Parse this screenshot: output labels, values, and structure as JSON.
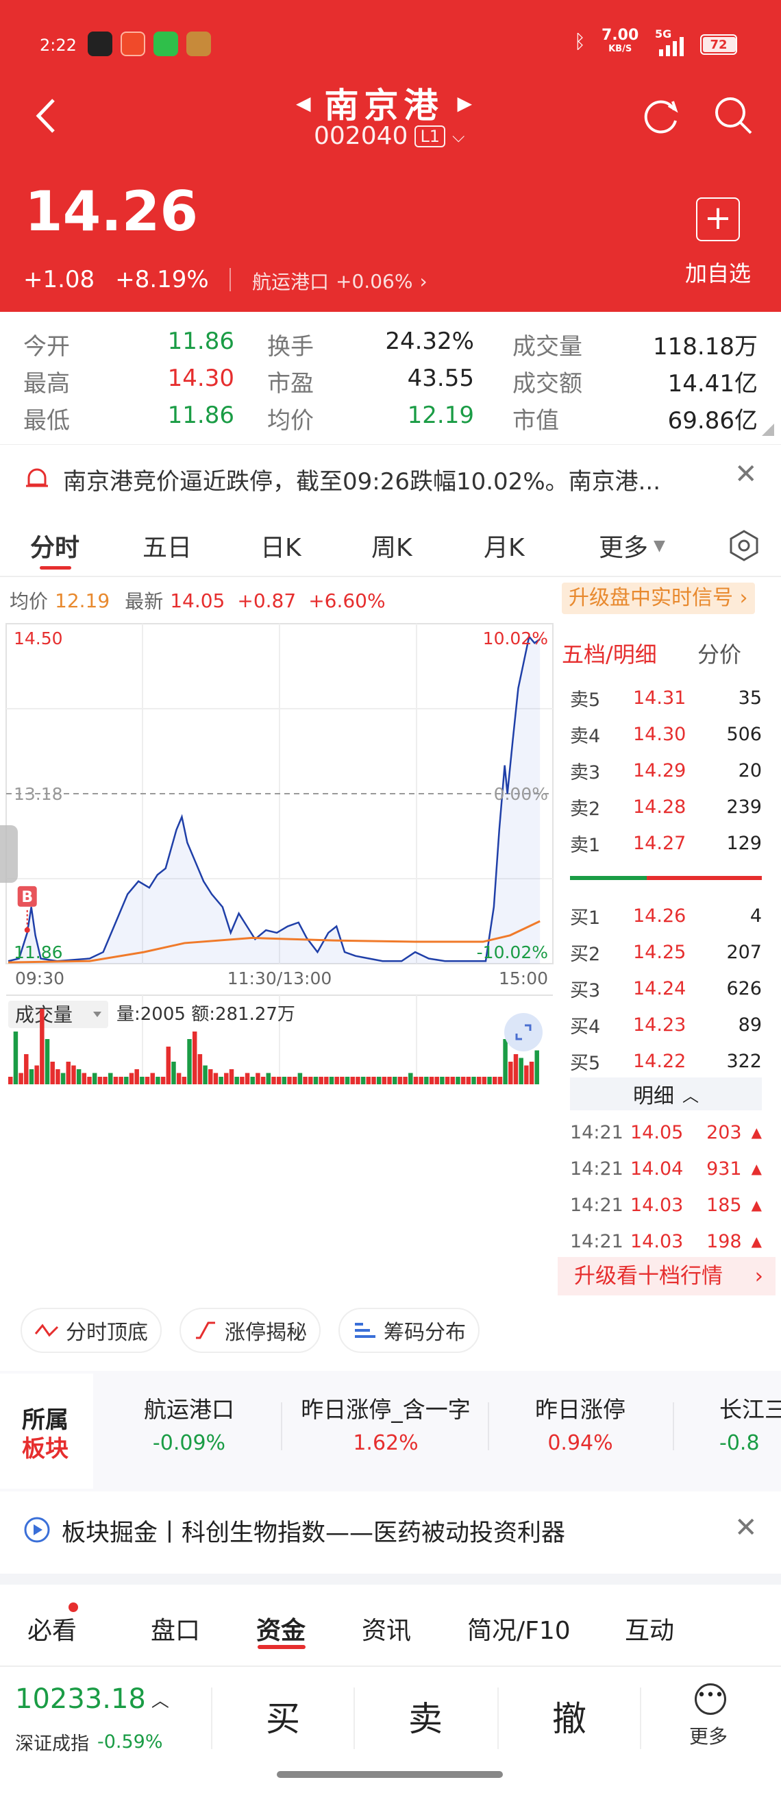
{
  "status": {
    "time": "2:22",
    "speed": "7.00",
    "speed_unit": "KB/S",
    "network": "5G",
    "battery": "72"
  },
  "header": {
    "stock_name": "南京港",
    "stock_code": "002040",
    "level": "L1"
  },
  "quote": {
    "price": "14.26",
    "change": "+1.08",
    "change_pct": "+8.19%",
    "sector_name": "航运港口",
    "sector_pct": "+0.06%",
    "add_label": "加自选"
  },
  "stats": [
    {
      "label": "今开",
      "value": "11.86",
      "color": "#1a9c45"
    },
    {
      "label": "换手",
      "value": "24.32%",
      "color": "#222222"
    },
    {
      "label": "成交量",
      "value": "118.18万",
      "color": "#222222"
    },
    {
      "label": "最高",
      "value": "14.30",
      "color": "#e62e2e"
    },
    {
      "label": "市盈",
      "value": "43.55",
      "color": "#222222"
    },
    {
      "label": "成交额",
      "value": "14.41亿",
      "color": "#222222"
    },
    {
      "label": "最低",
      "value": "11.86",
      "color": "#1a9c45"
    },
    {
      "label": "均价",
      "value": "12.19",
      "color": "#1a9c45"
    },
    {
      "label": "市值",
      "value": "69.86亿",
      "color": "#222222"
    }
  ],
  "notice": "南京港竞价逼近跌停，截至09:26跌幅10.02%。南京港...",
  "chart_tabs": [
    "分时",
    "五日",
    "日K",
    "周K",
    "月K",
    "更多"
  ],
  "info_bar": {
    "avg_label": "均价",
    "avg_value": "12.19",
    "latest_label": "最新",
    "latest_value": "14.05",
    "latest_change": "+0.87",
    "latest_pct": "+6.60%",
    "upgrade": "升级盘中实时信号 ›"
  },
  "chart_labels": {
    "top_price": "14.50",
    "top_pct": "10.02%",
    "mid_price": "13.18",
    "mid_pct": "0.00%",
    "bottom_price": "11.86",
    "bottom_pct": "-10.02%",
    "t_start": "09:30",
    "t_mid": "11:30/13:00",
    "t_end": "15:00",
    "buy_marker": "B"
  },
  "chart_data": {
    "type": "line",
    "ylim": [
      11.86,
      14.5
    ],
    "price_series": [
      [
        0,
        11.88
      ],
      [
        8,
        11.9
      ],
      [
        14,
        12.1
      ],
      [
        17,
        12.3
      ],
      [
        20,
        12.08
      ],
      [
        24,
        11.9
      ],
      [
        36,
        11.88
      ],
      [
        60,
        11.9
      ],
      [
        70,
        11.95
      ],
      [
        80,
        12.2
      ],
      [
        88,
        12.4
      ],
      [
        96,
        12.5
      ],
      [
        104,
        12.45
      ],
      [
        110,
        12.55
      ],
      [
        116,
        12.6
      ],
      [
        120,
        12.75
      ],
      [
        124,
        12.9
      ],
      [
        128,
        13.0
      ],
      [
        132,
        12.8
      ],
      [
        138,
        12.65
      ],
      [
        144,
        12.5
      ],
      [
        150,
        12.4
      ],
      [
        158,
        12.3
      ],
      [
        164,
        12.1
      ],
      [
        170,
        12.25
      ],
      [
        176,
        12.15
      ],
      [
        182,
        12.05
      ],
      [
        190,
        12.12
      ],
      [
        198,
        12.1
      ],
      [
        206,
        12.15
      ],
      [
        214,
        12.18
      ],
      [
        220,
        12.06
      ],
      [
        228,
        11.95
      ],
      [
        236,
        12.1
      ],
      [
        242,
        12.15
      ],
      [
        248,
        11.95
      ],
      [
        256,
        11.92
      ],
      [
        266,
        11.9
      ],
      [
        276,
        11.88
      ],
      [
        290,
        11.88
      ],
      [
        300,
        11.95
      ],
      [
        310,
        11.9
      ],
      [
        322,
        11.88
      ],
      [
        340,
        11.88
      ],
      [
        352,
        11.88
      ],
      [
        358,
        12.3
      ],
      [
        362,
        12.9
      ],
      [
        366,
        13.4
      ],
      [
        368,
        13.18
      ],
      [
        372,
        13.6
      ],
      [
        376,
        14.0
      ],
      [
        380,
        14.2
      ],
      [
        384,
        14.4
      ],
      [
        388,
        14.35
      ],
      [
        392,
        14.38
      ]
    ],
    "avg_series": [
      [
        0,
        11.87
      ],
      [
        60,
        11.88
      ],
      [
        100,
        11.95
      ],
      [
        130,
        12.02
      ],
      [
        180,
        12.06
      ],
      [
        240,
        12.04
      ],
      [
        300,
        12.03
      ],
      [
        350,
        12.03
      ],
      [
        370,
        12.08
      ],
      [
        392,
        12.19
      ]
    ],
    "volume_series": [
      2,
      14,
      3,
      8,
      4,
      5,
      20,
      12,
      6,
      4,
      3,
      6,
      5,
      4,
      3,
      2,
      3,
      2,
      2,
      3,
      2,
      2,
      2,
      3,
      4,
      2,
      2,
      3,
      2,
      2,
      10,
      6,
      3,
      2,
      12,
      14,
      8,
      5,
      4,
      3,
      2,
      3,
      4,
      2,
      2,
      3,
      2,
      3,
      2,
      3,
      2,
      2,
      2,
      2,
      2,
      3,
      2,
      2,
      2,
      2,
      2,
      2,
      2,
      2,
      2,
      2,
      2,
      2,
      2,
      2,
      2,
      2,
      2,
      2,
      2,
      2,
      3,
      2,
      2,
      2,
      2,
      2,
      2,
      2,
      2,
      2,
      2,
      2,
      2,
      2,
      2,
      2,
      2,
      2,
      12,
      6,
      8,
      7,
      5,
      6,
      9
    ],
    "volume_label": "成交量",
    "volume_info": "量:2005 额:281.27万"
  },
  "orderbook": {
    "header_left": "五档/明细",
    "header_right": "分价",
    "asks": [
      [
        "卖5",
        "14.31",
        "35"
      ],
      [
        "卖4",
        "14.30",
        "506"
      ],
      [
        "卖3",
        "14.29",
        "20"
      ],
      [
        "卖2",
        "14.28",
        "239"
      ],
      [
        "卖1",
        "14.27",
        "129"
      ]
    ],
    "bids": [
      [
        "买1",
        "14.26",
        "4"
      ],
      [
        "买2",
        "14.25",
        "207"
      ],
      [
        "买3",
        "14.24",
        "626"
      ],
      [
        "买4",
        "14.23",
        "89"
      ],
      [
        "买5",
        "14.22",
        "322"
      ]
    ],
    "detail_label": "明细",
    "ticks": [
      [
        "14:21",
        "14.05",
        "203"
      ],
      [
        "14:21",
        "14.04",
        "931"
      ],
      [
        "14:21",
        "14.03",
        "185"
      ],
      [
        "14:21",
        "14.03",
        "198"
      ]
    ],
    "upgrade": "升级看十档行情"
  },
  "pills": [
    "分时顶底",
    "涨停揭秘",
    "筹码分布"
  ],
  "sector_title": [
    "所属",
    "板块"
  ],
  "sectors": [
    {
      "name": "航运港口",
      "pct": "-0.09%",
      "color": "#1a9c45"
    },
    {
      "name": "昨日涨停_含一字",
      "pct": "1.62%",
      "color": "#e62e2e"
    },
    {
      "name": "昨日涨停",
      "pct": "0.94%",
      "color": "#e62e2e"
    },
    {
      "name": "长江三",
      "pct": "-0.8",
      "color": "#1a9c45"
    }
  ],
  "promo": "板块掘金丨科创生物指数——医药被动投资利器",
  "bottom_tabs": [
    "必看",
    "盘口",
    "资金",
    "资讯",
    "简况/F10",
    "互动"
  ],
  "footer": {
    "index_value": "10233.18",
    "index_name": "深证成指",
    "index_pct": "-0.59%",
    "buy": "买",
    "sell": "卖",
    "cancel": "撤",
    "more": "更多"
  }
}
